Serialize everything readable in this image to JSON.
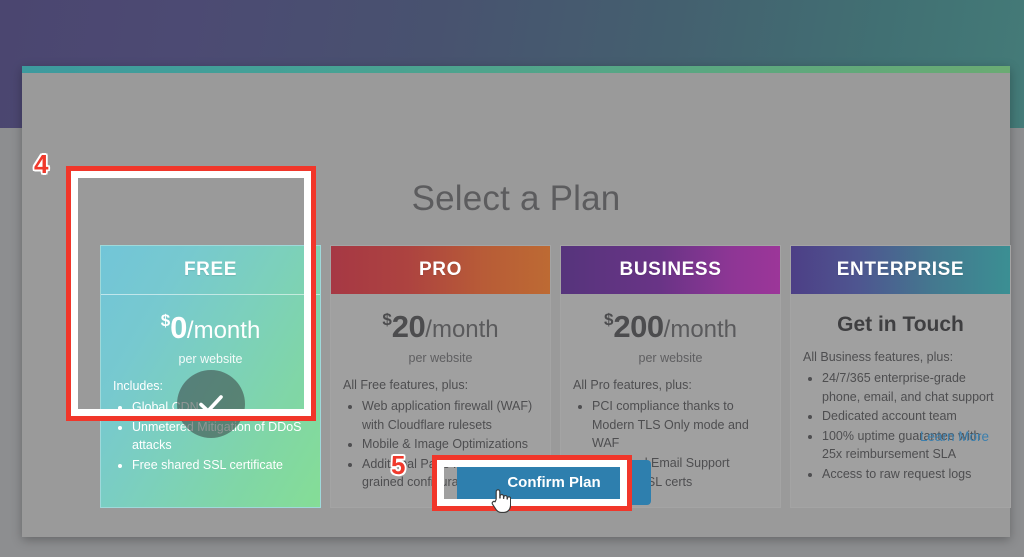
{
  "modal": {
    "title": "Select a Plan",
    "learn_more": "Learn More",
    "confirm_label": "Confirm Plan"
  },
  "plans": [
    {
      "name": "FREE",
      "selected": true,
      "currency": "$",
      "amount": "0",
      "period": "/month",
      "price_note": "per website",
      "plus_line": "Includes:",
      "features": [
        "Global CDN",
        "Unmetered Mitigation of DDoS attacks",
        "Free shared SSL certificate"
      ]
    },
    {
      "name": "PRO",
      "selected": false,
      "currency": "$",
      "amount": "20",
      "period": "/month",
      "price_note": "per website",
      "plus_line": "All Free features, plus:",
      "features": [
        "Web application firewall (WAF) with Cloudflare rulesets",
        "Mobile & Image Optimizations",
        "Additional Page Rules for fine-grained configuration"
      ]
    },
    {
      "name": "BUSINESS",
      "selected": false,
      "currency": "$",
      "amount": "200",
      "period": "/month",
      "price_note": "per website",
      "plus_line": "All Pro features, plus:",
      "features": [
        "PCI compliance thanks to Modern TLS Only mode and WAF",
        "Prioritized Email Support",
        "Custom SSL certs"
      ]
    },
    {
      "name": "ENTERPRISE",
      "selected": false,
      "contact_title": "Get in Touch",
      "plus_line": "All Business features, plus:",
      "features": [
        "24/7/365 enterprise-grade phone, email, and chat support",
        "Dedicated account team",
        "100% uptime guarantee with 25x reimbursement SLA",
        "Access to raw request logs"
      ]
    }
  ],
  "annotations": {
    "step_plan": "4",
    "step_confirm": "5"
  },
  "colors": {
    "annotation_red": "#f1362a",
    "confirm_blue": "#2e7fae",
    "link_blue": "#3b7fae",
    "modal_grey": "#9a9a9a"
  },
  "icons": {
    "check": "check-icon",
    "cursor": "hand-pointer-cursor"
  }
}
